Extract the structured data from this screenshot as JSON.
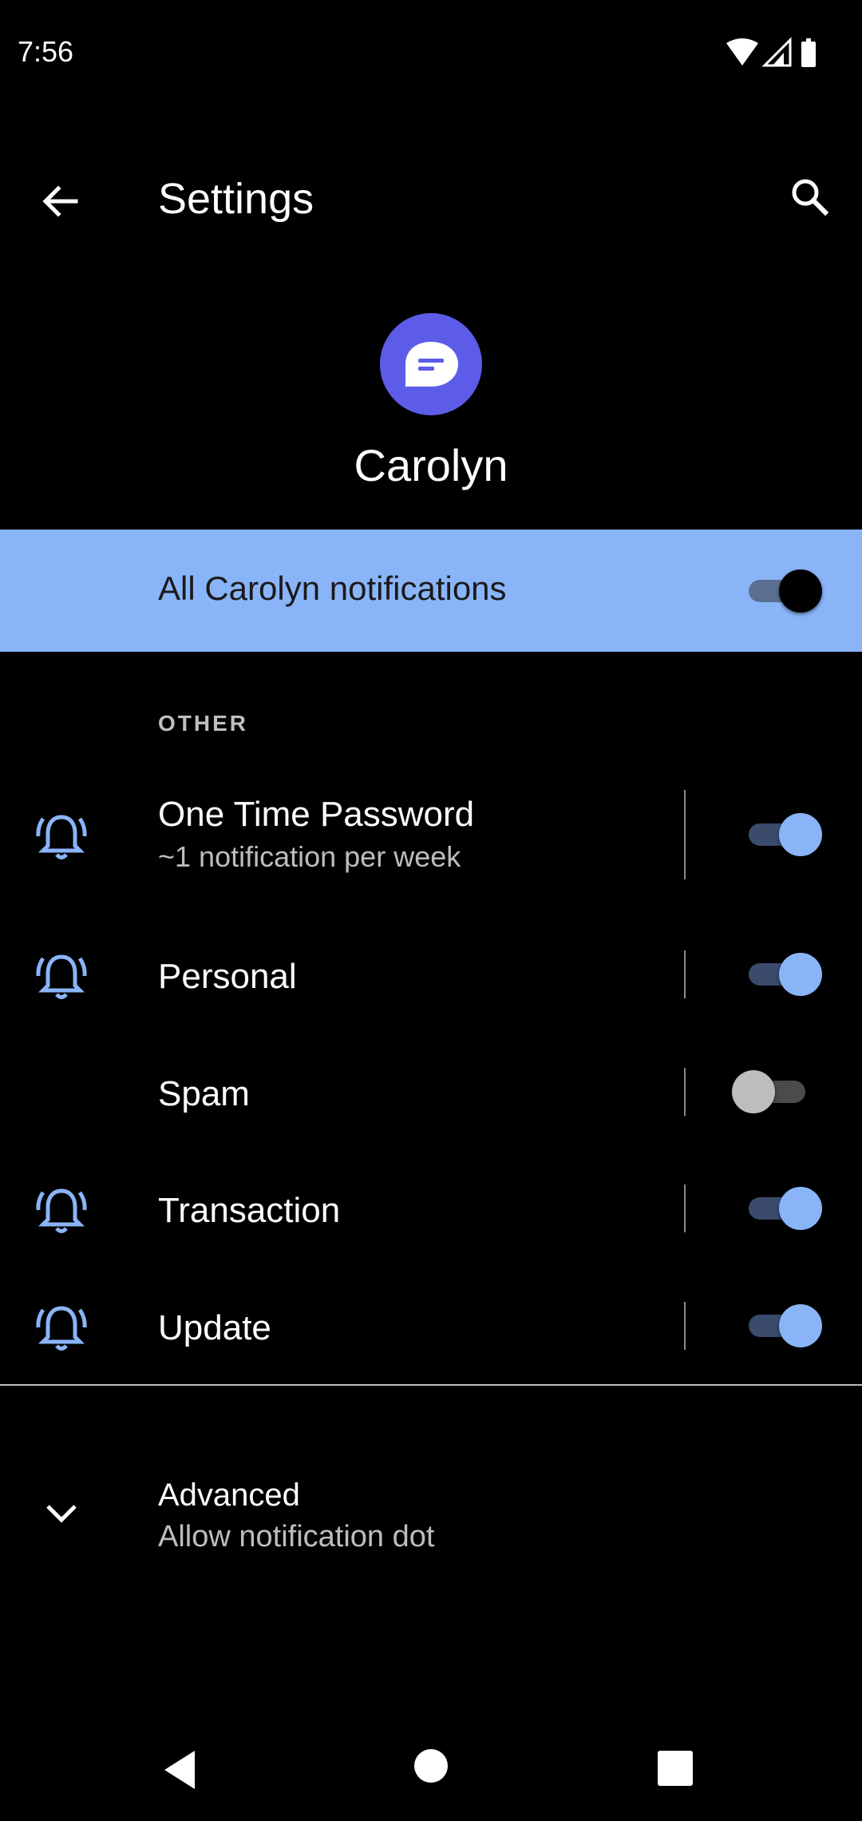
{
  "status_bar": {
    "time": "7:56",
    "icons": [
      "wifi-icon",
      "cell-signal-icon",
      "battery-icon"
    ]
  },
  "toolbar": {
    "title": "Settings",
    "back_icon": "back-arrow-icon",
    "search_icon": "search-icon"
  },
  "app": {
    "name": "Carolyn",
    "icon": "message-bubble-icon",
    "icon_color": "#5d5ce9"
  },
  "master_toggle": {
    "label": "All Carolyn notifications",
    "enabled": true,
    "background": "#8ab4f8"
  },
  "section": {
    "header": "OTHER"
  },
  "channels": [
    {
      "title": "One Time Password",
      "subtitle": "~1 notification per week",
      "icon": "alert-bell-icon",
      "enabled": true
    },
    {
      "title": "Personal",
      "subtitle": "",
      "icon": "alert-bell-icon",
      "enabled": true
    },
    {
      "title": "Spam",
      "subtitle": "",
      "icon": "",
      "enabled": false
    },
    {
      "title": "Transaction",
      "subtitle": "",
      "icon": "alert-bell-icon",
      "enabled": true
    },
    {
      "title": "Update",
      "subtitle": "",
      "icon": "alert-bell-icon",
      "enabled": true
    }
  ],
  "advanced": {
    "title": "Advanced",
    "subtitle": "Allow notification dot",
    "icon": "chevron-down-icon"
  },
  "nav_bar": {
    "icons": [
      "nav-back-icon",
      "nav-home-icon",
      "nav-recents-icon"
    ]
  },
  "colors": {
    "accent": "#8ab4f8",
    "background": "#000000"
  }
}
